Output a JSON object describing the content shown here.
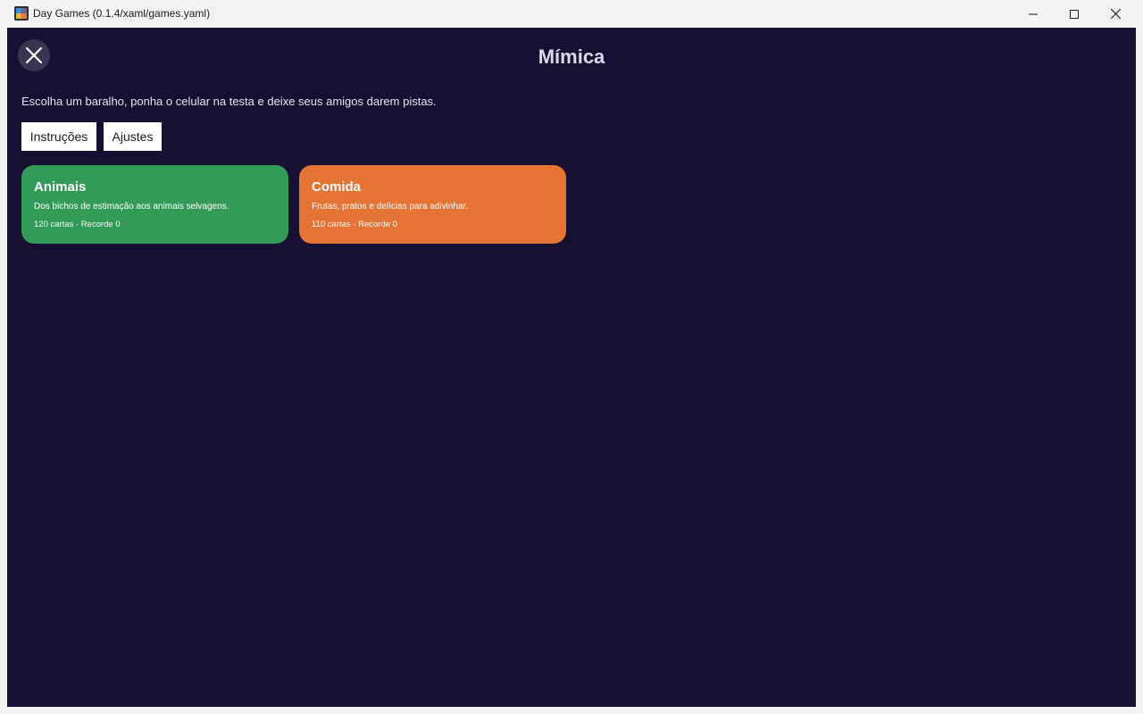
{
  "window": {
    "title": "Day Games (0.1.4/xaml/games.yaml)",
    "icon": "app-grid-icon"
  },
  "header": {
    "title": "Mímica",
    "close_icon": "close-icon"
  },
  "intro": {
    "text": "Escolha um baralho, ponha o celular na testa e deixe seus amigos darem pistas."
  },
  "toolbar": {
    "instructions_label": "Instruções",
    "settings_label": "Ajustes"
  },
  "decks": [
    {
      "title": "Animais",
      "description": "Dos bichos de estimação aos animais selvagens.",
      "meta": "120 cartas · Recorde 0",
      "color": "#339b58"
    },
    {
      "title": "Comida",
      "description": "Frutas, pratos e delícias para adivinhar.",
      "meta": "110 cartas · Recorde 0",
      "color": "#e57334"
    }
  ],
  "colors": {
    "background": "#171033",
    "titlebar": "#f3f3f3"
  }
}
